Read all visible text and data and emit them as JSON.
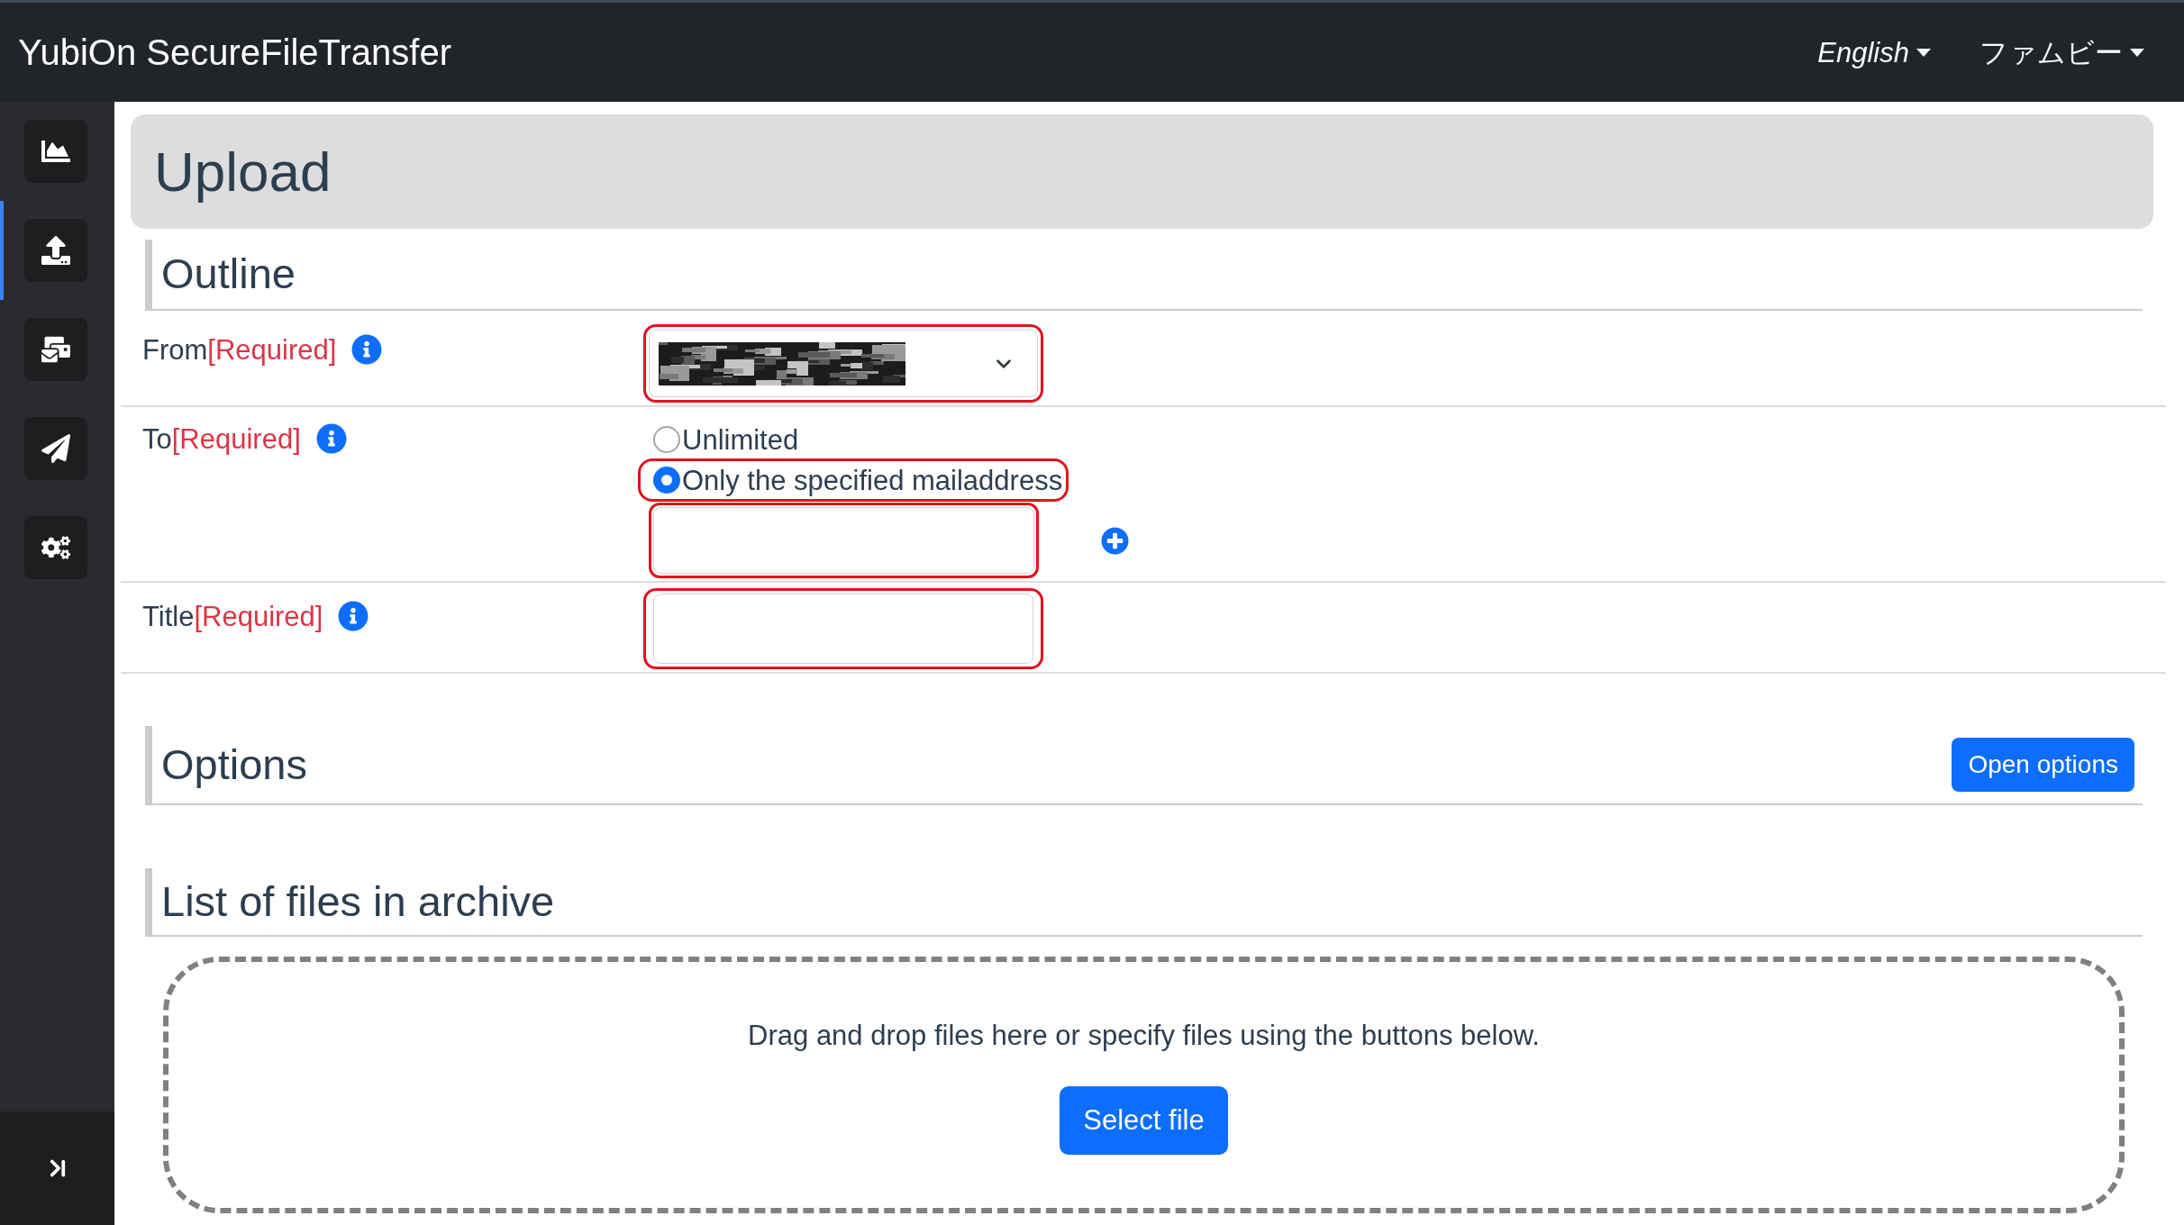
{
  "header": {
    "title": "YubiOn SecureFileTransfer",
    "menus": [
      {
        "label": "English",
        "italic": true
      },
      {
        "label": "ファムビー",
        "italic": false
      }
    ]
  },
  "sidebar": {
    "items": [
      {
        "selected": false
      },
      {
        "selected": true
      },
      {
        "selected": false
      },
      {
        "selected": false
      },
      {
        "selected": false
      }
    ]
  },
  "page_title": "Upload",
  "outline": {
    "heading": "Outline",
    "rows": [
      {
        "kind": "select",
        "label": "From",
        "required_note": "[Required]",
        "value_redacted": true,
        "highlighted": true
      },
      {
        "kind": "radio",
        "label": "To",
        "required_note": "[Required]",
        "options": [
          {
            "label": "Unlimited",
            "selected": false,
            "highlighted": false
          },
          {
            "label": "Only the specified mailaddress",
            "selected": true,
            "highlighted": true
          }
        ],
        "input": {
          "highlighted": true
        }
      },
      {
        "kind": "text",
        "label": "Title",
        "required_note": "[Required]",
        "highlighted": true
      }
    ]
  },
  "options": {
    "heading": "Options",
    "button": "Open options"
  },
  "files": {
    "heading": "List of files in archive",
    "dropzone_text": "Drag and drop files here or specify files using the buttons below.",
    "button": "Select file"
  }
}
